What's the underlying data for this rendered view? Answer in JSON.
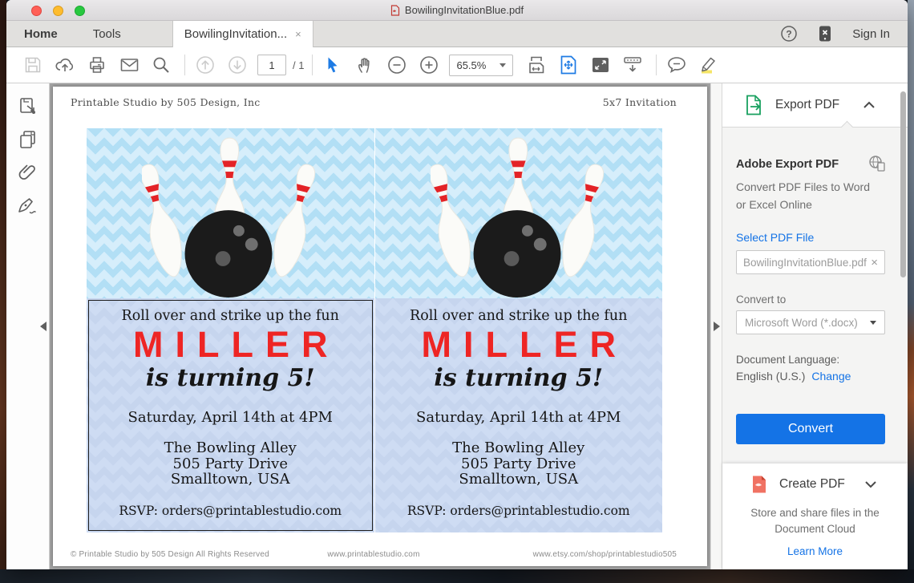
{
  "colors": {
    "accent_blue": "#1473e6",
    "select_tool_blue": "#1e7be4",
    "invite_red": "#ee2524",
    "pin_stripe_red": "#e32327",
    "export_green": "#18a05f",
    "create_pdf_red": "#ef6a5a",
    "chevron_bg_light": "#d6eefb",
    "chevron_bg_dark": "#b2dff5",
    "invite_panel_blue": "#cedcf3"
  },
  "titlebar": {
    "title": "BowilingInvitationBlue.pdf"
  },
  "tabbar": {
    "home": "Home",
    "tools": "Tools",
    "document_tab": "BowilingInvitation...",
    "close_tab": "×",
    "sign_in": "Sign In"
  },
  "toolbar": {
    "page_number": "1",
    "page_total": "/ 1",
    "zoom_level": "65.5%",
    "icons": [
      "save",
      "cloud-upload",
      "print",
      "email",
      "search",
      "previous-page",
      "next-page",
      "select-tool",
      "hand-tool",
      "zoom-out",
      "zoom-in",
      "fit-width",
      "fit-page",
      "fullscreen",
      "scroll-mode",
      "comment",
      "highlight"
    ]
  },
  "left_rail_icons": [
    "export-page",
    "page-thumbnails",
    "attachments",
    "fill-sign"
  ],
  "document": {
    "header_left": "Printable Studio by 505 Design, Inc",
    "header_right": "5x7 Invitation",
    "invitation": {
      "tagline": "Roll over and strike up the fun",
      "name": "MILLER",
      "subtitle": "is turning 5!",
      "datetime": "Saturday, April 14th at 4PM",
      "venue_name": "The Bowling Alley",
      "venue_street": "505 Party Drive",
      "venue_city": "Smalltown, USA",
      "rsvp": "RSVP: orders@printablestudio.com"
    },
    "footer_left": "© Printable Studio by 505 Design All Rights Reserved",
    "footer_center": "www.printablestudio.com",
    "footer_right": "www.etsy.com/shop/printablestudio505"
  },
  "export_panel": {
    "title": "Export PDF",
    "section_title": "Adobe Export PDF",
    "description": "Convert PDF Files to Word or Excel Online",
    "select_file_link": "Select PDF File",
    "selected_file": "BowilingInvitationBlue.pdf",
    "remove_file": "×",
    "convert_to_label": "Convert to",
    "convert_to_value": "Microsoft Word (*.docx)",
    "language_label": "Document Language:",
    "language_value": "English (U.S.)",
    "change_link": "Change",
    "convert_button": "Convert"
  },
  "create_panel": {
    "title": "Create PDF",
    "description_line1": "Store and share files in the",
    "description_line2": "Document Cloud",
    "learn_more_link": "Learn More"
  }
}
